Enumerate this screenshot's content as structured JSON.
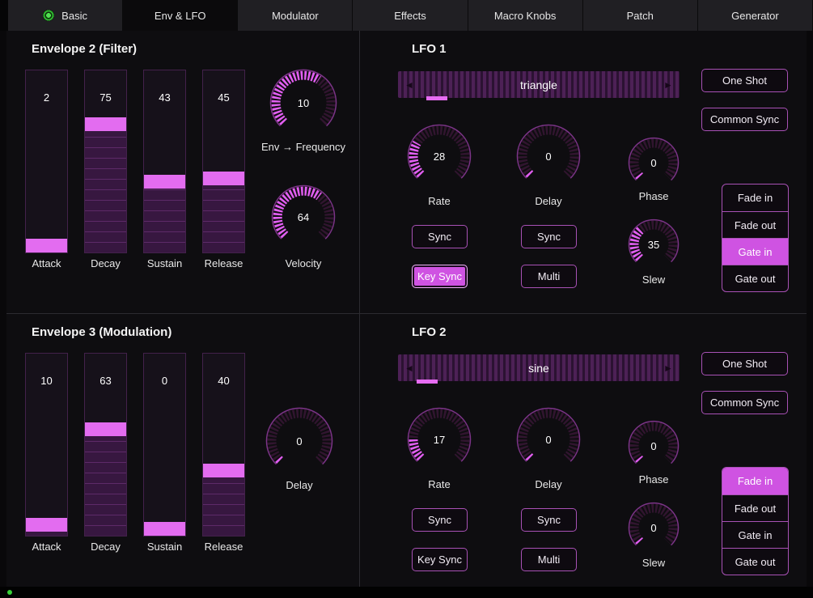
{
  "colors": {
    "accent": "#e25ff2",
    "accent_dim": "#3a1941",
    "button_border": "#a851b5",
    "selected_fill": "#cf53e2",
    "led_green": "#38d038"
  },
  "tabs": [
    {
      "label": "Basic",
      "selected": false
    },
    {
      "label": "Env & LFO",
      "selected": true
    },
    {
      "label": "Modulator",
      "selected": false
    },
    {
      "label": "Effects",
      "selected": false
    },
    {
      "label": "Macro Knobs",
      "selected": false
    },
    {
      "label": "Patch",
      "selected": false
    },
    {
      "label": "Generator",
      "selected": false
    }
  ],
  "env2": {
    "title": "Envelope 2 (Filter)",
    "sliders": [
      {
        "label": "Attack",
        "value": 2
      },
      {
        "label": "Decay",
        "value": 75
      },
      {
        "label": "Sustain",
        "value": 43
      },
      {
        "label": "Release",
        "value": 45
      }
    ],
    "knobs": [
      {
        "label": "Env → Frequency",
        "value": 10,
        "max": 16
      },
      {
        "label": "Velocity",
        "value": 64
      }
    ]
  },
  "env3": {
    "title": "Envelope 3 (Modulation)",
    "sliders": [
      {
        "label": "Attack",
        "value": 10
      },
      {
        "label": "Decay",
        "value": 63
      },
      {
        "label": "Sustain",
        "value": 0
      },
      {
        "label": "Release",
        "value": 40
      }
    ],
    "knobs": [
      {
        "label": "Delay",
        "value": 0
      }
    ]
  },
  "lfo1": {
    "title": "LFO 1",
    "waveform": {
      "value": "triangle",
      "left_arrow": "◄",
      "right_arrow": "►",
      "indicator_pos": 0.1
    },
    "knobs": [
      {
        "label": "Rate",
        "value": 28
      },
      {
        "label": "Delay",
        "value": 0
      },
      {
        "label": "Phase",
        "value": 0
      },
      {
        "label": "Slew",
        "value": 35
      }
    ],
    "buttons": {
      "one_shot": {
        "label": "One Shot",
        "selected": false
      },
      "common_sync": {
        "label": "Common Sync",
        "selected": false
      },
      "rate_sync": {
        "label": "Sync",
        "selected": false
      },
      "delay_sync": {
        "label": "Sync",
        "selected": false
      },
      "key_sync": {
        "label": "Key Sync",
        "selected": true
      },
      "multi": {
        "label": "Multi",
        "selected": false
      }
    },
    "fade_gate": [
      {
        "label": "Fade in",
        "selected": false
      },
      {
        "label": "Fade out",
        "selected": false
      },
      {
        "label": "Gate in",
        "selected": true
      },
      {
        "label": "Gate out",
        "selected": false
      }
    ]
  },
  "lfo2": {
    "title": "LFO 2",
    "waveform": {
      "value": "sine",
      "left_arrow": "◄",
      "right_arrow": "►",
      "indicator_pos": 0.065
    },
    "knobs": [
      {
        "label": "Rate",
        "value": 17
      },
      {
        "label": "Delay",
        "value": 0
      },
      {
        "label": "Phase",
        "value": 0
      },
      {
        "label": "Slew",
        "value": 0
      }
    ],
    "buttons": {
      "one_shot": {
        "label": "One Shot",
        "selected": false
      },
      "common_sync": {
        "label": "Common Sync",
        "selected": false
      },
      "rate_sync": {
        "label": "Sync",
        "selected": false
      },
      "delay_sync": {
        "label": "Sync",
        "selected": false
      },
      "key_sync": {
        "label": "Key Sync",
        "selected": false
      },
      "multi": {
        "label": "Multi",
        "selected": false
      }
    },
    "fade_gate": [
      {
        "label": "Fade in",
        "selected": true
      },
      {
        "label": "Fade out",
        "selected": false
      },
      {
        "label": "Gate in",
        "selected": false
      },
      {
        "label": "Gate out",
        "selected": false
      }
    ]
  }
}
